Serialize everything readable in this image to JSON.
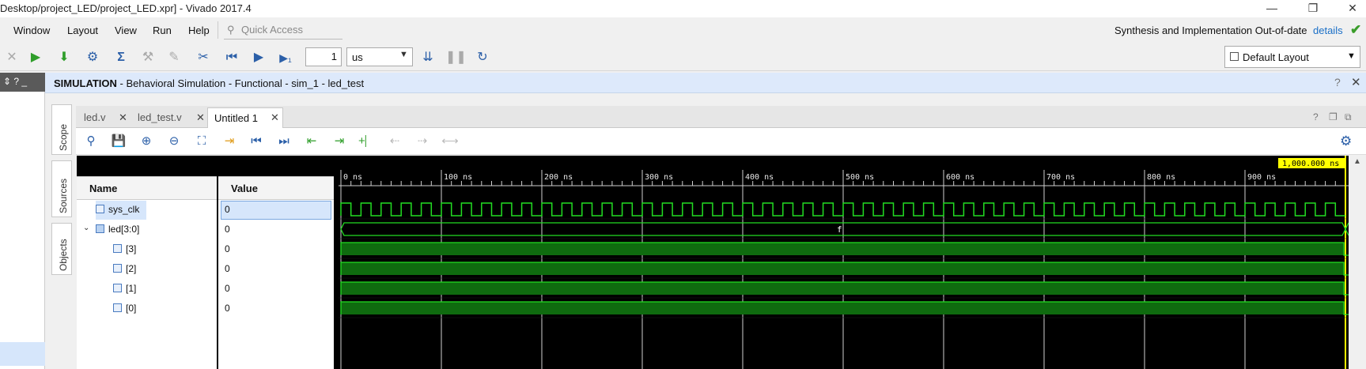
{
  "window": {
    "title": "Desktop/project_LED/project_LED.xpr] - Vivado 2017.4",
    "controls": [
      "—",
      "❐",
      "✕"
    ]
  },
  "menu": {
    "items": [
      "Window",
      "Layout",
      "View",
      "Run",
      "Help"
    ],
    "quick_access_placeholder": "Quick Access",
    "status": "Synthesis and Implementation Out-of-date",
    "details_link": "details"
  },
  "toolbar": {
    "time_value": "1",
    "time_unit": "us",
    "layout": "Default Layout"
  },
  "left_panel": {
    "header_icons": "⇕ ? _"
  },
  "simulation": {
    "label_bold": "SIMULATION",
    "label_rest": " - Behavioral Simulation - Functional - sim_1 - led_test",
    "side_tabs": [
      "Scope",
      "Sources",
      "Objects"
    ]
  },
  "tabs": [
    {
      "label": "led.v",
      "active": false
    },
    {
      "label": "led_test.v",
      "active": false
    },
    {
      "label": "Untitled 1",
      "active": true
    }
  ],
  "wave": {
    "columns": {
      "name": "Name",
      "value": "Value"
    },
    "signals": [
      {
        "name": "sys_clk",
        "value": "0",
        "indent": 0,
        "type": "clock"
      },
      {
        "name": "led[3:0]",
        "value": "0",
        "indent": 0,
        "type": "bus",
        "expanded": true,
        "bus_label": "f"
      },
      {
        "name": "[3]",
        "value": "0",
        "indent": 1,
        "type": "bit"
      },
      {
        "name": "[2]",
        "value": "0",
        "indent": 1,
        "type": "bit"
      },
      {
        "name": "[1]",
        "value": "0",
        "indent": 1,
        "type": "bit"
      },
      {
        "name": "[0]",
        "value": "0",
        "indent": 1,
        "type": "bit"
      }
    ],
    "time_ticks": [
      "0 ns",
      "100 ns",
      "200 ns",
      "300 ns",
      "400 ns",
      "500 ns",
      "600 ns",
      "700 ns",
      "800 ns",
      "900 ns"
    ],
    "cursor_label": "1,000.000 ns",
    "colors": {
      "wave": "#22dd22",
      "bus_fill": "#0f6b0f",
      "grid": "#cfcfcf",
      "cursor": "#ffff00"
    }
  }
}
